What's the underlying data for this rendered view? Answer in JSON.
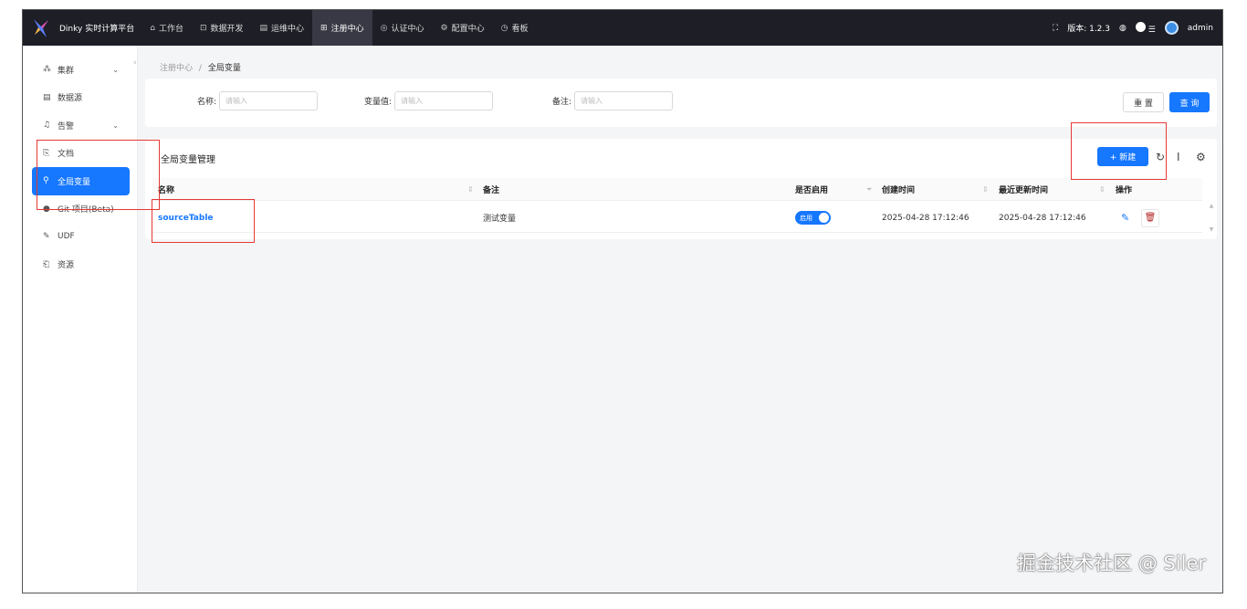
{
  "header": {
    "brand": "Dinky 实时计算平台",
    "nav": [
      {
        "label": "工作台",
        "icon": "home-icon",
        "glyph": "⌂"
      },
      {
        "label": "数据开发",
        "icon": "code-icon",
        "glyph": "⊡"
      },
      {
        "label": "运维中心",
        "icon": "monitor-icon",
        "glyph": "▤"
      },
      {
        "label": "注册中心",
        "icon": "grid-icon",
        "glyph": "⊞"
      },
      {
        "label": "认证中心",
        "icon": "shield-check-icon",
        "glyph": "◎"
      },
      {
        "label": "配置中心",
        "icon": "gear-icon",
        "glyph": "⚙"
      },
      {
        "label": "看板",
        "icon": "dashboard-icon",
        "glyph": "◷"
      }
    ],
    "version": "版本: 1.2.3",
    "user": "admin"
  },
  "sidebar": {
    "items": [
      {
        "label": "集群",
        "glyph": "⁂",
        "caret": "⌄"
      },
      {
        "label": "数据源",
        "glyph": "▤",
        "caret": ""
      },
      {
        "label": "告警",
        "glyph": "♫",
        "caret": "⌄"
      },
      {
        "label": "文档",
        "glyph": "⎘",
        "caret": ""
      },
      {
        "label": "全局变量",
        "glyph": "⚲",
        "caret": ""
      },
      {
        "label": "Git 项目(Beta)",
        "glyph": "●",
        "caret": ""
      },
      {
        "label": "UDF",
        "glyph": "✎",
        "caret": ""
      },
      {
        "label": "资源",
        "glyph": "⎗",
        "caret": ""
      }
    ],
    "active_index": 4
  },
  "breadcrumb": {
    "parent": "注册中心",
    "separator": "/",
    "current": "全局变量"
  },
  "search": {
    "name_label": "名称:",
    "name_placeholder": "请输入",
    "value_label": "变量值:",
    "value_placeholder": "请输入",
    "note_label": "备注:",
    "note_placeholder": "请输入",
    "reset_label": "重 置",
    "query_label": "查 询"
  },
  "table": {
    "title": "全局变量管理",
    "new_label": "+ 新建",
    "columns": [
      "名称",
      "备注",
      "是否启用",
      "创建时间",
      "最近更新时间",
      "操作"
    ],
    "rows": [
      {
        "name": "sourceTable",
        "note": "测试变量",
        "enabled_label": "启用",
        "enabled": true,
        "created": "2025-04-28 17:12:46",
        "updated": "2025-04-28 17:12:46"
      }
    ]
  },
  "watermark": "掘金技术社区 @ Siler",
  "colors": {
    "primary": "#1677ff",
    "header_bg": "#1d1e26",
    "annotation": "#e53935"
  }
}
